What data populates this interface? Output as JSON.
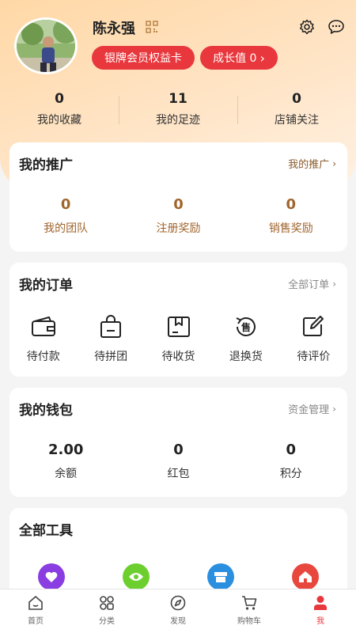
{
  "profile": {
    "name": "陈永强",
    "member_card_label": "银牌会员权益卡",
    "growth_label": "成长值 0",
    "growth_chevron": "›"
  },
  "stats": [
    {
      "value": "0",
      "label": "我的收藏"
    },
    {
      "value": "11",
      "label": "我的足迹"
    },
    {
      "value": "0",
      "label": "店铺关注"
    }
  ],
  "promotion": {
    "title": "我的推广",
    "link": "我的推广",
    "items": [
      {
        "value": "0",
        "label": "我的团队"
      },
      {
        "value": "0",
        "label": "注册奖励"
      },
      {
        "value": "0",
        "label": "销售奖励"
      }
    ]
  },
  "orders": {
    "title": "我的订单",
    "link": "全部订单",
    "items": [
      {
        "label": "待付款",
        "icon": "wallet-icon"
      },
      {
        "label": "待拼团",
        "icon": "bag-icon"
      },
      {
        "label": "待收货",
        "icon": "package-icon"
      },
      {
        "label": "退换货",
        "icon": "exchange-icon",
        "icon_text": "售"
      },
      {
        "label": "待评价",
        "icon": "edit-icon"
      }
    ]
  },
  "wallet": {
    "title": "我的钱包",
    "link": "资金管理",
    "items": [
      {
        "value": "2.00",
        "label": "余额"
      },
      {
        "value": "0",
        "label": "红包"
      },
      {
        "value": "0",
        "label": "积分"
      }
    ]
  },
  "tools": {
    "title": "全部工具",
    "items": [
      {
        "icon": "heart-icon",
        "color": "#8a3de0"
      },
      {
        "icon": "eye-icon",
        "color": "#6ccf2e"
      },
      {
        "icon": "store-icon",
        "color": "#2b8fe0"
      },
      {
        "icon": "house-icon",
        "color": "#e8473d"
      }
    ]
  },
  "chevron": "›",
  "tabs": [
    {
      "label": "首页",
      "icon": "home-icon"
    },
    {
      "label": "分类",
      "icon": "category-icon"
    },
    {
      "label": "发现",
      "icon": "compass-icon"
    },
    {
      "label": "购物车",
      "icon": "cart-icon"
    },
    {
      "label": "我",
      "icon": "user-icon",
      "active": true
    }
  ],
  "colors": {
    "accent": "#e8383d",
    "promo_text": "#a0652d",
    "header_gradient_start": "#ffd8a6"
  }
}
